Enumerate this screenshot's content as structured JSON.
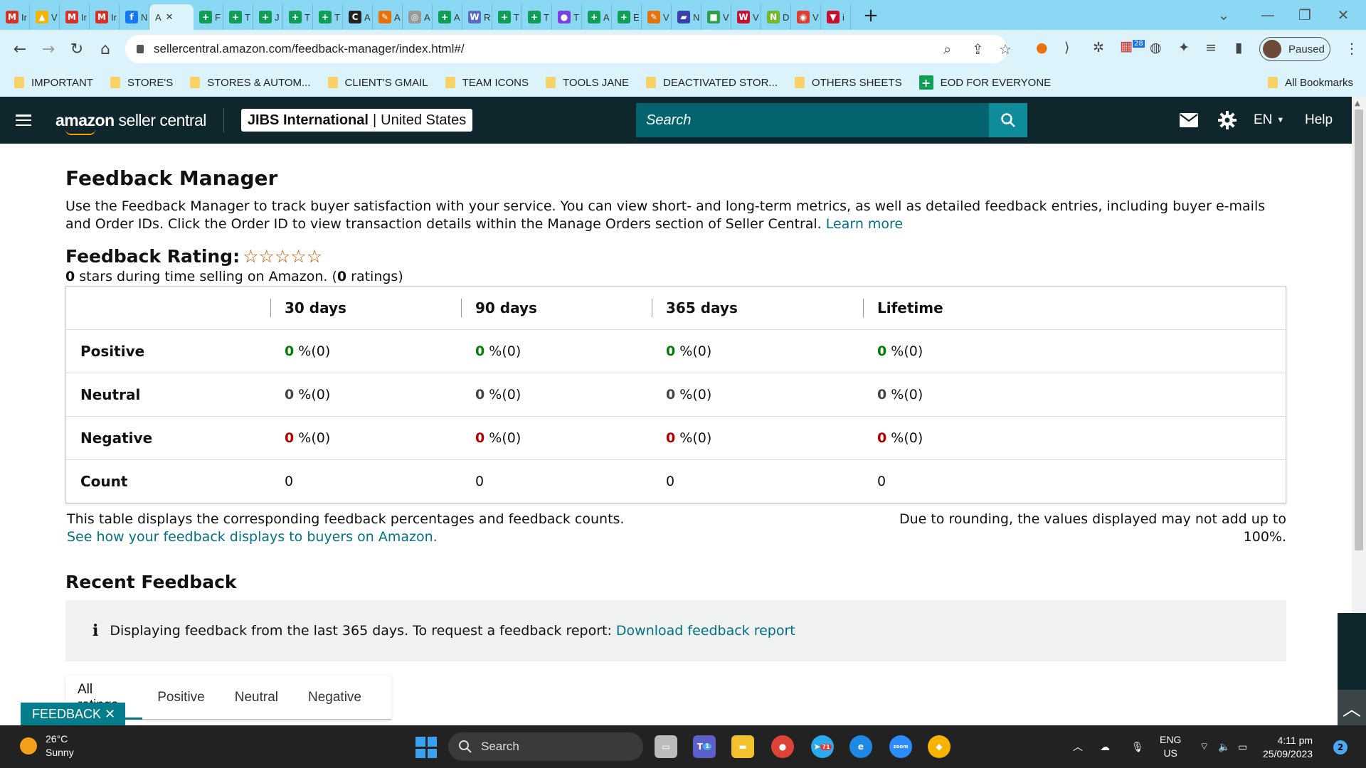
{
  "browser": {
    "tabs": [
      {
        "letter": "M",
        "label": "Ir",
        "color": "#d93025"
      },
      {
        "letter": "▲",
        "label": "V",
        "color": "#f4b400"
      },
      {
        "letter": "M",
        "label": "Ir",
        "color": "#d93025"
      },
      {
        "letter": "M",
        "label": "Ir",
        "color": "#d93025"
      },
      {
        "letter": "f",
        "label": "N",
        "color": "#1877f2"
      },
      {
        "letter": "+",
        "label": "F",
        "color": "#0f9d58"
      },
      {
        "letter": "+",
        "label": "T",
        "color": "#0f9d58"
      },
      {
        "letter": "+",
        "label": "J",
        "color": "#0f9d58"
      },
      {
        "letter": "+",
        "label": "T",
        "color": "#0f9d58"
      },
      {
        "letter": "+",
        "label": "T",
        "color": "#0f9d58"
      },
      {
        "letter": "C",
        "label": "A",
        "color": "#222222"
      },
      {
        "letter": "✎",
        "label": "A",
        "color": "#e8710a"
      },
      {
        "letter": "◎",
        "label": "A",
        "color": "#999999"
      },
      {
        "letter": "+",
        "label": "A",
        "color": "#0f9d58"
      },
      {
        "letter": "W",
        "label": "R",
        "color": "#5b6bbf"
      },
      {
        "letter": "+",
        "label": "T",
        "color": "#0f9d58"
      },
      {
        "letter": "+",
        "label": "T",
        "color": "#0f9d58"
      },
      {
        "letter": "●",
        "label": "T",
        "color": "#7b3fe4"
      },
      {
        "letter": "+",
        "label": "A",
        "color": "#0f9d58"
      },
      {
        "letter": "+",
        "label": "E",
        "color": "#0f9d58"
      },
      {
        "letter": "✎",
        "label": "V",
        "color": "#e8710a"
      },
      {
        "letter": "▰",
        "label": "N",
        "color": "#3b3fb0"
      },
      {
        "letter": "■",
        "label": "V",
        "color": "#2f9e44"
      },
      {
        "letter": "W",
        "label": "V",
        "color": "#c8102e"
      },
      {
        "letter": "N",
        "label": "D",
        "color": "#76b82a"
      },
      {
        "letter": "◉",
        "label": "V",
        "color": "#e03c31"
      },
      {
        "letter": "▼",
        "label": "i",
        "color": "#c8102e"
      }
    ],
    "active_tab": {
      "label": "A",
      "close": "✕"
    },
    "new_tab": "+",
    "url": "sellercentral.amazon.com/feedback-manager/index.html#/",
    "profile_label": "Paused",
    "extension_badge": "28",
    "bookmarks": [
      "IMPORTANT",
      "STORE'S",
      "STORES & AUTOM...",
      "CLIENT'S GMAIL",
      "TEAM ICONS",
      "TOOLS JANE",
      "DEACTIVATED STOR...",
      "OTHERS SHEETS",
      "EOD FOR EVERYONE"
    ],
    "all_bookmarks": "All Bookmarks"
  },
  "header": {
    "logo_bold": "amazon",
    "logo_light": " seller central",
    "account_name": "JIBS International",
    "account_region": "United States",
    "search_placeholder": "Search",
    "language": "EN",
    "help": "Help"
  },
  "page": {
    "title": "Feedback Manager",
    "intro": "Use the Feedback Manager to track buyer satisfaction with your service. You can view short- and long-term metrics, as well as detailed feedback entries, including buyer e-mails and Order IDs. Click the Order ID to view transaction details within the Manage Orders section of Seller Central.",
    "learn_more": "Learn more",
    "rating_label": "Feedback Rating:",
    "rating_value": 0,
    "stars_count": "0",
    "stars_text": " stars during time selling on Amazon. (",
    "ratings_count": "0",
    "ratings_text": " ratings)",
    "table": {
      "columns": [
        "30 days",
        "90 days",
        "365 days",
        "Lifetime"
      ],
      "rows": [
        {
          "label": "Positive",
          "type": "pos",
          "values": [
            {
              "pct": "0",
              "count": "%(0)"
            },
            {
              "pct": "0",
              "count": "%(0)"
            },
            {
              "pct": "0",
              "count": "%(0)"
            },
            {
              "pct": "0",
              "count": "%(0)"
            }
          ]
        },
        {
          "label": "Neutral",
          "type": "neu",
          "values": [
            {
              "pct": "0",
              "count": "%(0)"
            },
            {
              "pct": "0",
              "count": "%(0)"
            },
            {
              "pct": "0",
              "count": "%(0)"
            },
            {
              "pct": "0",
              "count": "%(0)"
            }
          ]
        },
        {
          "label": "Negative",
          "type": "neg",
          "values": [
            {
              "pct": "0",
              "count": "%(0)"
            },
            {
              "pct": "0",
              "count": "%(0)"
            },
            {
              "pct": "0",
              "count": "%(0)"
            },
            {
              "pct": "0",
              "count": "%(0)"
            }
          ]
        },
        {
          "label": "Count",
          "type": "count",
          "values": [
            {
              "pct": "",
              "count": "0"
            },
            {
              "pct": "",
              "count": "0"
            },
            {
              "pct": "",
              "count": "0"
            },
            {
              "pct": "",
              "count": "0"
            }
          ]
        }
      ]
    },
    "table_note": "This table displays the corresponding feedback percentages and feedback counts.",
    "table_link": "See how your feedback displays to buyers on Amazon.",
    "rounding_note": "Due to rounding, the values displayed may not add up to 100%.",
    "recent_title": "Recent Feedback",
    "info_icon": "i",
    "info_text": "Displaying feedback from the last 365 days. To request a feedback report: ",
    "info_link": "Download feedback report",
    "filter_tabs": [
      "All ratings",
      "Positive",
      "Neutral",
      "Negative"
    ],
    "feedback_widget": "FEEDBACK ✕"
  },
  "colors": {
    "positive": "#067d06",
    "negative": "#b10000",
    "link": "#007185",
    "header_bg": "#0f262d",
    "search_bg": "#03646f"
  },
  "taskbar": {
    "temperature": "26°C",
    "weather": "Sunny",
    "search": "Search",
    "lang1": "ENG",
    "lang2": "US",
    "time": "4:11 pm",
    "date": "25/09/2023",
    "notifications": "2",
    "telegram_badge": "71",
    "teams_badge": "1",
    "zoom_label": "zoom"
  }
}
